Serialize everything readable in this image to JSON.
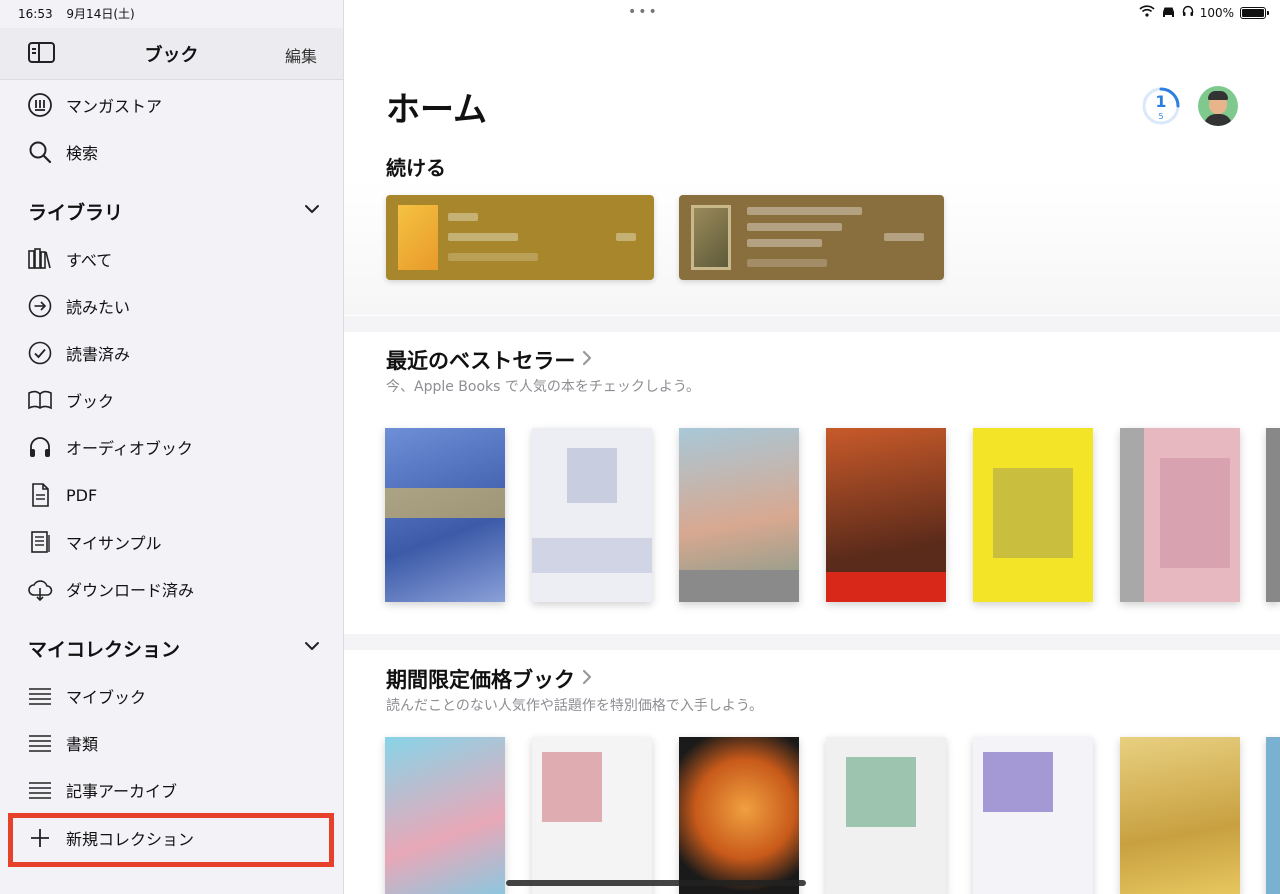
{
  "status_bar": {
    "time": "16:53",
    "date": "9月14日(土)",
    "battery_percent": "100%"
  },
  "sidebar": {
    "title": "ブック",
    "edit_label": "編集",
    "top_items": [
      {
        "label": "マンガストア",
        "icon": "manga-store-icon"
      },
      {
        "label": "検索",
        "icon": "search-icon"
      }
    ],
    "library": {
      "title": "ライブラリ",
      "items": [
        {
          "label": "すべて",
          "icon": "books-icon"
        },
        {
          "label": "読みたい",
          "icon": "arrow-circle-icon"
        },
        {
          "label": "読書済み",
          "icon": "check-circle-icon"
        },
        {
          "label": "ブック",
          "icon": "open-book-icon"
        },
        {
          "label": "オーディオブック",
          "icon": "headphones-icon"
        },
        {
          "label": "PDF",
          "icon": "document-icon"
        },
        {
          "label": "マイサンプル",
          "icon": "sample-icon"
        },
        {
          "label": "ダウンロード済み",
          "icon": "cloud-download-icon"
        }
      ]
    },
    "collections": {
      "title": "マイコレクション",
      "items": [
        {
          "label": "マイブック",
          "icon": "list-icon"
        },
        {
          "label": "書類",
          "icon": "list-icon"
        },
        {
          "label": "記事アーカイブ",
          "icon": "list-icon"
        }
      ],
      "new_label": "新規コレクション"
    }
  },
  "main": {
    "title": "ホーム",
    "reading_goal": {
      "value": "1",
      "sub": "5"
    },
    "continue": {
      "title": "続ける"
    },
    "bestsellers": {
      "title": "最近のベストセラー",
      "subtitle": "今、Apple Books で人気の本をチェックしよう。"
    },
    "limited": {
      "title": "期間限定価格ブック",
      "subtitle": "読んだことのない人気作や話題作を特別価格で入手しよう。"
    }
  },
  "colors": {
    "accent_highlight": "#e8412b",
    "ring_blue": "#2b7fe0",
    "card_gold": "#a8872c",
    "card_brown": "#8a6f3e"
  }
}
